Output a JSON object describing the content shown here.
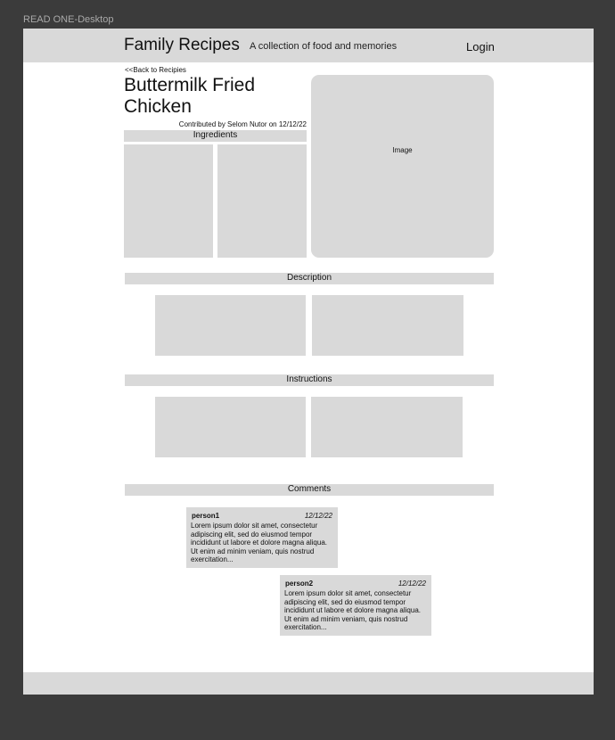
{
  "frame": {
    "label": "READ ONE-Desktop"
  },
  "header": {
    "site_title": "Family Recipes",
    "tagline": "A collection of food and memories",
    "login_label": "Login"
  },
  "recipe": {
    "back_link": "<<Back to Recipies",
    "title": "Buttermilk Fried Chicken",
    "contributed": "Contributed by Selom Nutor on 12/12/22",
    "image_label": "Image"
  },
  "sections": {
    "ingredients": "Ingredients",
    "description": "Description",
    "instructions": "Instructions",
    "comments": "Comments"
  },
  "comments": [
    {
      "user": "person1",
      "date": "12/12/22",
      "text": "Lorem ipsum dolor sit amet, consectetur adipiscing elit, sed do eiusmod tempor incididunt ut labore et dolore magna aliqua. Ut enim ad minim veniam, quis nostrud exercitation..."
    },
    {
      "user": "person2",
      "date": "12/12/22",
      "text": "Lorem ipsum dolor sit amet, consectetur adipiscing elit, sed do eiusmod tempor incididunt ut labore et dolore magna aliqua. Ut enim ad minim veniam, quis nostrud exercitation..."
    }
  ],
  "colors": {
    "canvas": "#3b3b3b",
    "page": "#ffffff",
    "placeholder": "#d9d9d9"
  }
}
